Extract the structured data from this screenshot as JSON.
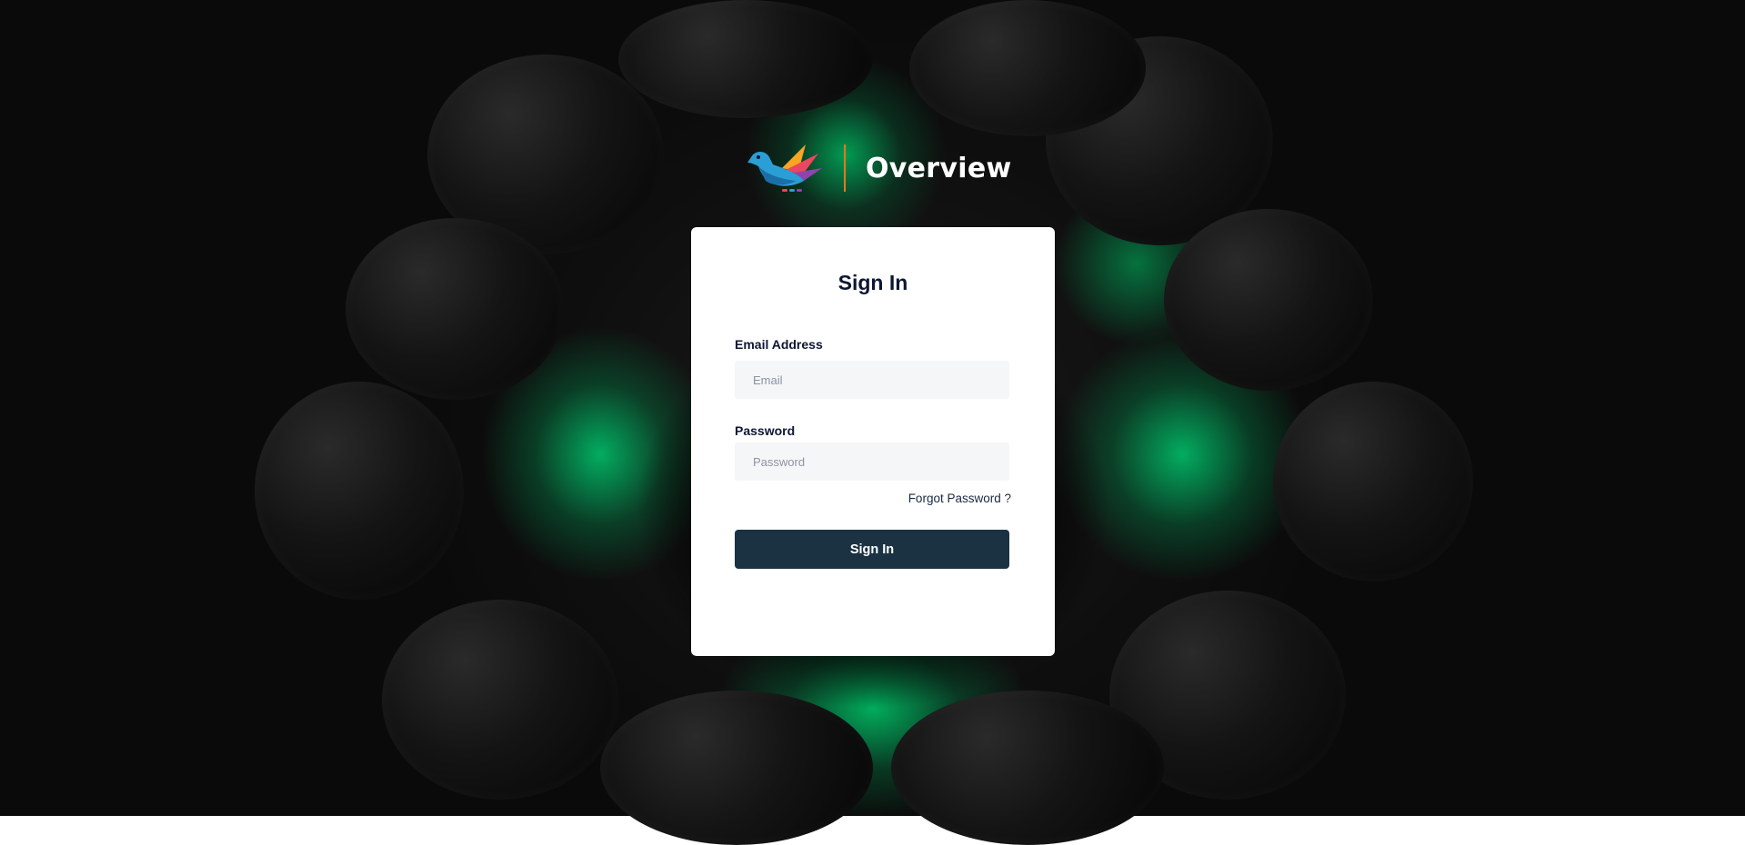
{
  "brand": {
    "name": "Overview",
    "logo_icon": "bird-logo-icon",
    "divider_color": "#e07a20"
  },
  "signin_card": {
    "title": "Sign In",
    "email": {
      "label": "Email Address",
      "placeholder": "Email",
      "value": ""
    },
    "password": {
      "label": "Password",
      "placeholder": "Password",
      "value": ""
    },
    "forgot_password_label": "Forgot Password ?",
    "submit_label": "Sign In"
  },
  "colors": {
    "background": "#0b0b0b",
    "accent_green": "#00b86b",
    "button": "#1b3243",
    "title_text": "#0d1733"
  }
}
